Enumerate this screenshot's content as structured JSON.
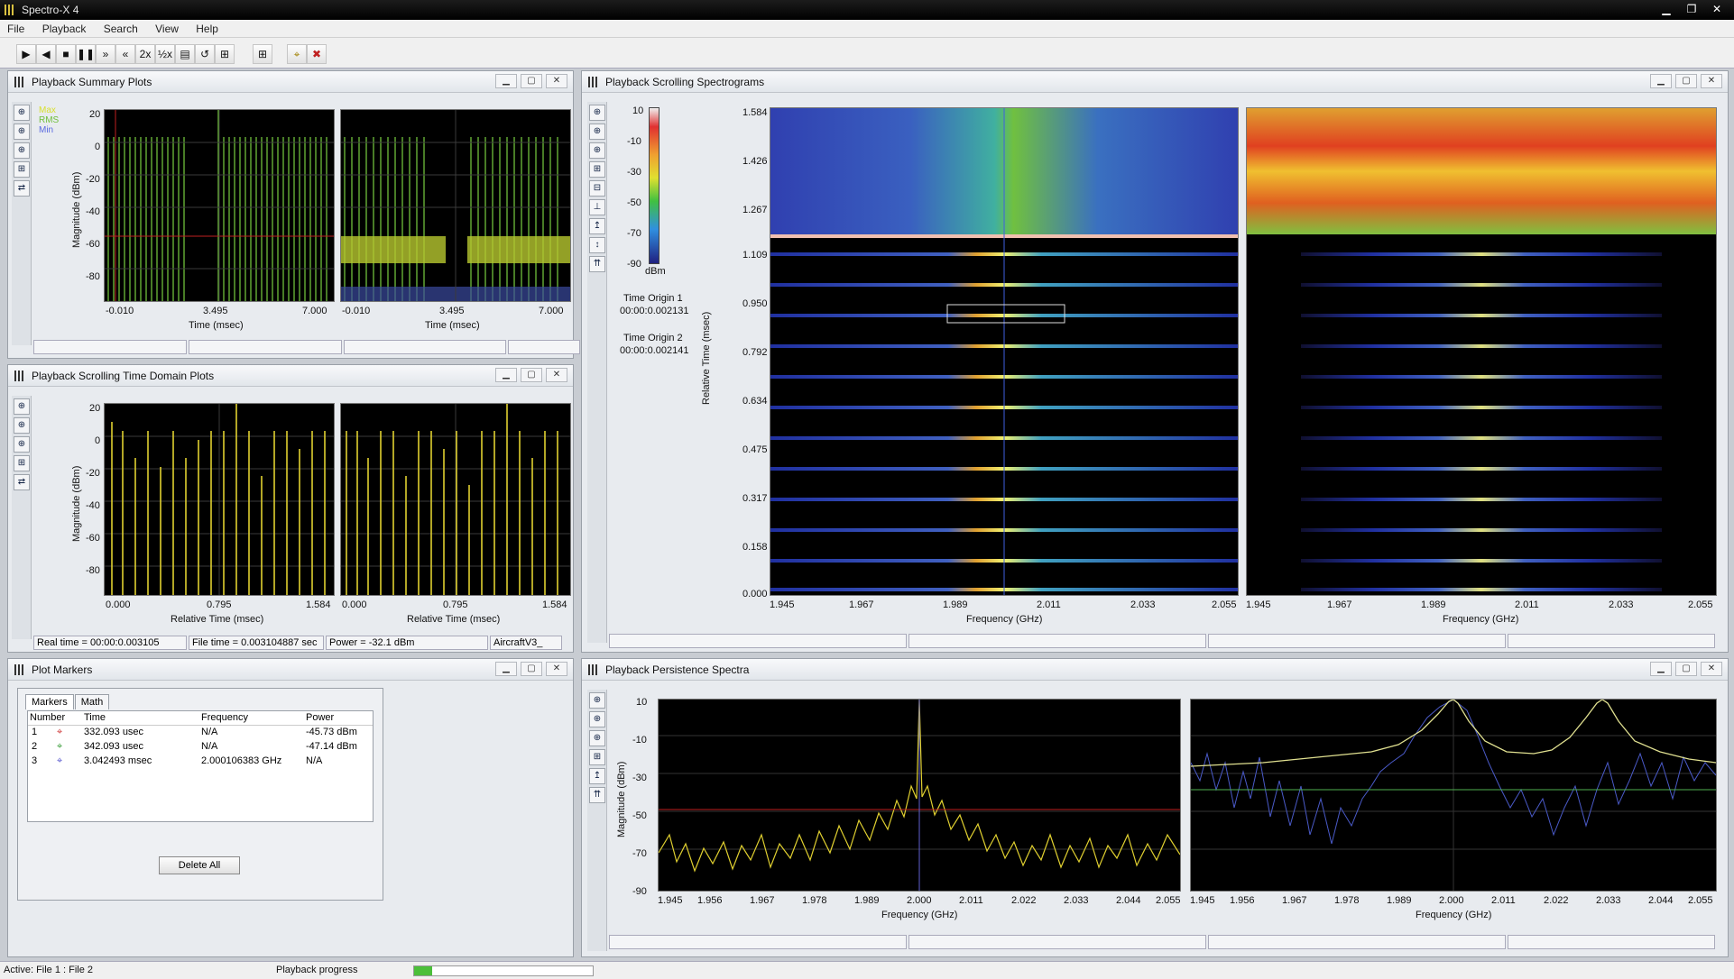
{
  "app": {
    "title": "Spectro-X 4"
  },
  "menu": [
    "File",
    "Playback",
    "Search",
    "View",
    "Help"
  ],
  "toolbar": {
    "buttons": [
      {
        "glyph": "▶",
        "icon": "play-icon"
      },
      {
        "glyph": "◀",
        "icon": "reverse-play-icon"
      },
      {
        "glyph": "■",
        "icon": "stop-icon"
      },
      {
        "glyph": "❚❚",
        "icon": "pause-icon"
      },
      {
        "glyph": "»",
        "icon": "fast-forward-icon"
      },
      {
        "glyph": "«",
        "icon": "rewind-icon"
      },
      {
        "glyph": "2x",
        "icon": "double-speed-icon"
      },
      {
        "glyph": "½x",
        "icon": "half-speed-icon"
      },
      {
        "glyph": "▤",
        "icon": "display-icon"
      },
      {
        "glyph": "↺",
        "icon": "loop-icon"
      },
      {
        "glyph": "⊞",
        "icon": "layout-icon"
      },
      {
        "glyph": "⊞",
        "icon": "grid-icon"
      },
      {
        "glyph": "⌖",
        "icon": "search-icon"
      },
      {
        "glyph": "✖",
        "icon": "clear-search-icon"
      }
    ]
  },
  "summary": {
    "title": "Playback Summary Plots",
    "legend": [
      "Max",
      "RMS",
      "Min"
    ],
    "legend_colors": [
      "#d8e030",
      "#6fbf3a",
      "#5a6ae0"
    ],
    "ylabel": "Magnitude (dBm)",
    "yticks": [
      "20",
      "0",
      "-20",
      "-40",
      "-60",
      "-80"
    ],
    "xticks": [
      "-0.010",
      "3.495",
      "7.000"
    ],
    "xlabel": "Time (msec)"
  },
  "timedomain": {
    "title": "Playback Scrolling Time Domain Plots",
    "ylabel": "Magnitude (dBm)",
    "yticks": [
      "20",
      "0",
      "-20",
      "-40",
      "-60",
      "-80"
    ],
    "xticks": [
      "0.000",
      "0.795",
      "1.584"
    ],
    "xlabel": "Relative Time (msec)",
    "status": [
      "Real time = 00:00:0.003105",
      "File time = 0.003104887 sec",
      "Power = -32.1 dBm",
      "AircraftV3_"
    ]
  },
  "markers": {
    "title": "Plot Markers",
    "tabs": [
      "Markers",
      "Math"
    ],
    "columns": [
      "Number",
      "Time",
      "Frequency",
      "Power"
    ],
    "rows": [
      {
        "num": "1",
        "color": "#d04040",
        "time": "332.093 usec",
        "freq": "N/A",
        "power": "-45.73 dBm"
      },
      {
        "num": "2",
        "color": "#40a040",
        "time": "342.093 usec",
        "freq": "N/A",
        "power": "-47.14 dBm"
      },
      {
        "num": "3",
        "color": "#6060d0",
        "time": "3.042493 msec",
        "freq": "2.000106383 GHz",
        "power": "N/A"
      }
    ],
    "delete_label": "Delete All"
  },
  "spectrograms": {
    "title": "Playback Scrolling Spectrograms",
    "colorbar_ticks": [
      "10",
      "-10",
      "-30",
      "-50",
      "-70",
      "-90"
    ],
    "colorbar_unit": "dBm",
    "origin1_label": "Time Origin 1",
    "origin1_value": "00:00:0.002131",
    "origin2_label": "Time Origin 2",
    "origin2_value": "00:00:0.002141",
    "ylabel": "Relative Time (msec)",
    "yticks": [
      "1.584",
      "1.426",
      "1.267",
      "1.109",
      "0.950",
      "0.792",
      "0.634",
      "0.475",
      "0.317",
      "0.158",
      "0.000"
    ],
    "xticks": [
      "1.945",
      "1.967",
      "1.989",
      "2.011",
      "2.033",
      "2.055"
    ],
    "xlabel": "Frequency (GHz)"
  },
  "persistence": {
    "title": "Playback Persistence Spectra",
    "ylabel": "Magnitude (dBm)",
    "yticks": [
      "10",
      "-10",
      "-30",
      "-50",
      "-70",
      "-90"
    ],
    "xticks": [
      "1.945",
      "1.956",
      "1.967",
      "1.978",
      "1.989",
      "2.000",
      "2.011",
      "2.022",
      "2.033",
      "2.044",
      "2.055"
    ],
    "xlabel": "Frequency (GHz)"
  },
  "status": {
    "active": "Active: File 1 : File 2",
    "progress_label": "Playback progress",
    "progress_fraction": 0.1
  }
}
